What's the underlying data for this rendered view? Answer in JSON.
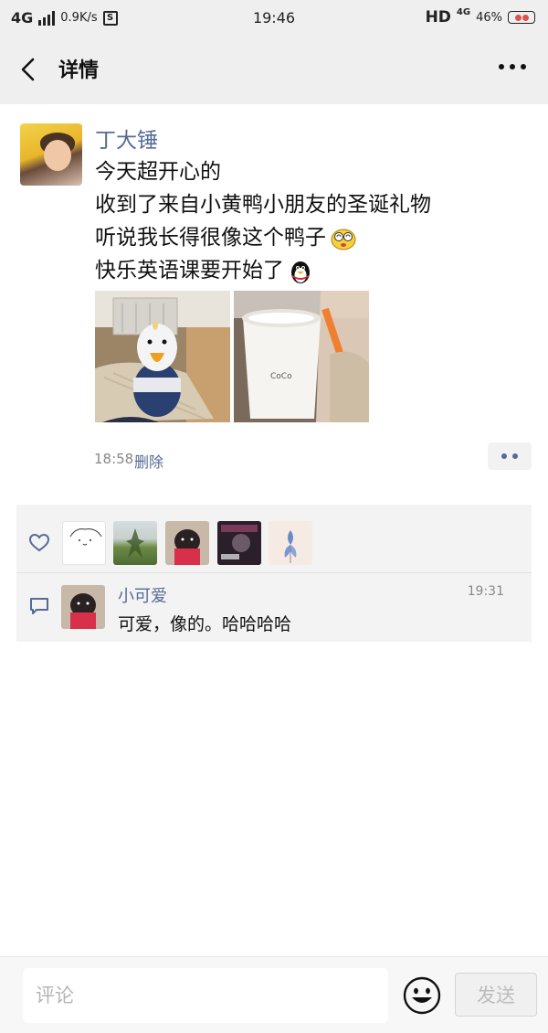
{
  "status_bar": {
    "network": "4G",
    "speed": "0.9K/s",
    "time": "19:46",
    "hd": "HD",
    "net_small": "4G",
    "battery": "46%"
  },
  "header": {
    "title": "详情",
    "back_icon": "chevron-left-icon",
    "more_icon": "more-icon"
  },
  "post": {
    "author": "丁大锤",
    "lines": [
      "今天超开心的",
      "收到了来自小黄鸭小朋友的圣诞礼物",
      "听说我长得很像这个鸭子",
      "快乐英语课要开始了"
    ],
    "time": "18:58",
    "delete_label": "删除",
    "photo_cup_text": "CoCo"
  },
  "likes": {
    "icon": "heart-icon",
    "count_shown": 5
  },
  "comment": {
    "icon": "comment-icon",
    "name": "小可爱",
    "time": "19:31",
    "text": "可爱，像的。哈哈哈哈"
  },
  "input_bar": {
    "placeholder": "评论",
    "emoji_icon": "smiley-icon",
    "send_label": "发送"
  },
  "colors": {
    "link": "#566b94",
    "background_gray": "#efefef",
    "panel": "#f3f3f3"
  }
}
